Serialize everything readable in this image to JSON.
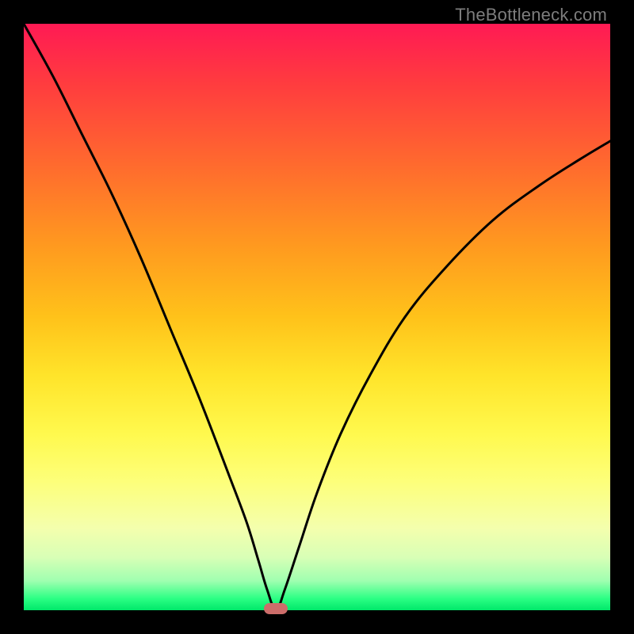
{
  "watermark": "TheBottleneck.com",
  "colors": {
    "curve": "#000000",
    "marker": "#cc6d6a",
    "frame_bg": "#000000"
  },
  "chart_data": {
    "type": "line",
    "title": "",
    "xlabel": "",
    "ylabel": "",
    "xlim": [
      0,
      1
    ],
    "ylim": [
      0,
      1
    ],
    "grid": false,
    "legend": false,
    "annotations": [],
    "marker": {
      "x": 0.43,
      "y": 0.0,
      "shape": "rounded-rect",
      "color": "#cc6d6a"
    },
    "series": [
      {
        "name": "left-branch",
        "x": [
          0.0,
          0.05,
          0.1,
          0.15,
          0.2,
          0.25,
          0.3,
          0.35,
          0.38,
          0.4,
          0.415,
          0.43
        ],
        "y": [
          1.0,
          0.91,
          0.81,
          0.71,
          0.6,
          0.48,
          0.36,
          0.23,
          0.15,
          0.085,
          0.035,
          0.0
        ]
      },
      {
        "name": "right-branch",
        "x": [
          0.43,
          0.445,
          0.47,
          0.5,
          0.54,
          0.59,
          0.65,
          0.72,
          0.8,
          0.88,
          0.95,
          1.0
        ],
        "y": [
          0.0,
          0.035,
          0.11,
          0.2,
          0.3,
          0.4,
          0.5,
          0.585,
          0.665,
          0.725,
          0.77,
          0.8
        ]
      }
    ]
  }
}
